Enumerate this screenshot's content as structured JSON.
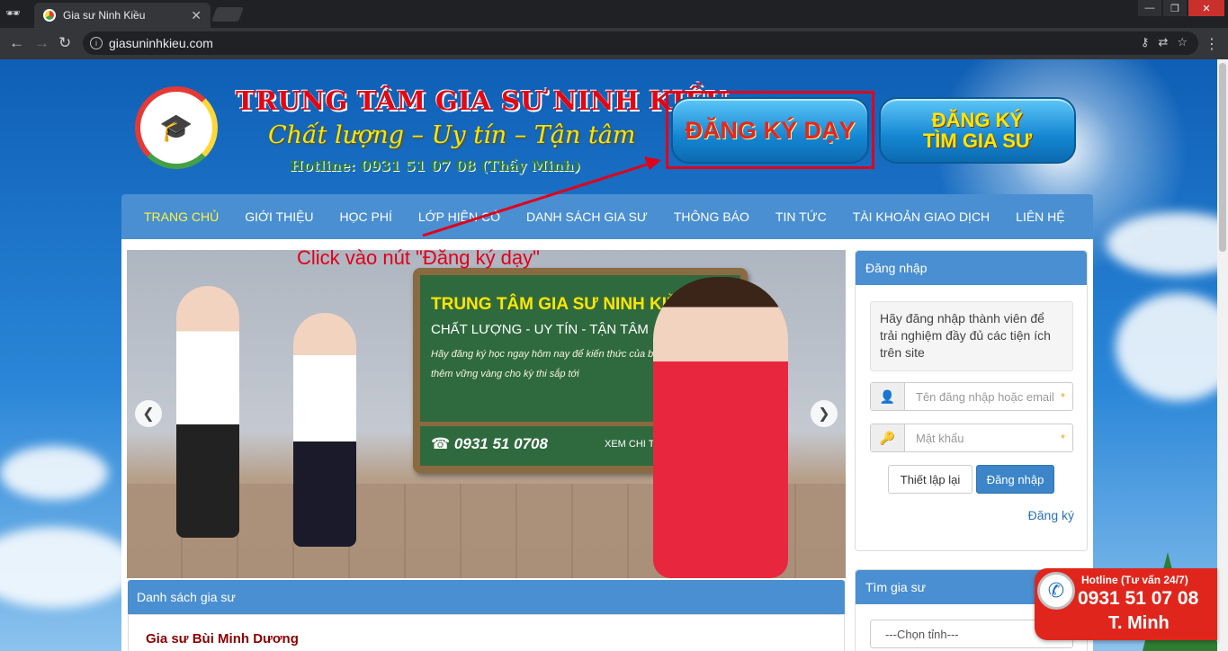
{
  "browser": {
    "tab_title": "Gia sư Ninh Kiều",
    "tab_close": "✕",
    "url": "giasuninhkieu.com",
    "window_buttons": [
      "—",
      "❐",
      "✕"
    ]
  },
  "header": {
    "title": "TRUNG TÂM GIA SƯ NINH KIỀU",
    "slogan": "Chất lượng – Uy tín – Tận tâm",
    "hotline": "Hotline: 0931 51 07 08 (Thầy Minh)",
    "register_teach": "ĐĂNG KÝ DẠY",
    "register_find_line1": "ĐĂNG KÝ",
    "register_find_line2": "TÌM GIA SƯ"
  },
  "nav": {
    "items": [
      "TRANG CHỦ",
      "GIỚI THIỆU",
      "HỌC PHÍ",
      "LỚP HIỆN CÓ",
      "DANH SÁCH GIA SƯ",
      "THÔNG BÁO",
      "TIN TỨC",
      "TÀI KHOẢN GIAO DỊCH",
      "LIÊN HỆ"
    ],
    "active": "TRANG CHỦ"
  },
  "annotation": "Click vào nút \"Đăng ký dạy\"",
  "slider": {
    "board_title": "TRUNG TÂM GIA SƯ NINH KIỀU",
    "board_subtitle": "CHẤT LƯỢNG - UY TÍN - TẬN TÂM",
    "board_line1": "Hãy đăng ký học ngay hôm nay để kiến thức của bạn",
    "board_line2": "thêm vững vàng cho kỳ thi sắp tới",
    "board_phone": "0931 51 0708",
    "board_more": "XEM CHI TIẾT >>",
    "prev": "❮",
    "next": "❯"
  },
  "login": {
    "heading": "Đăng nhập",
    "note": "Hãy đăng nhập thành viên để trải nghiệm đầy đủ các tiện ích trên site",
    "username_placeholder": "Tên đăng nhập hoặc email",
    "password_placeholder": "Mật khẩu",
    "required_mark": "*",
    "reset_label": "Thiết lập lại",
    "submit_label": "Đăng nhập",
    "register_link": "Đăng ký"
  },
  "find_tutor": {
    "heading": "Tìm gia sư",
    "province_select": "---Chọn tỉnh---"
  },
  "tutor_list": {
    "heading": "Danh sách gia sư",
    "first_tutor": "Gia sư Bùi Minh Dương"
  },
  "hotline_badge": {
    "line1": "Hotline (Tư vấn 24/7)",
    "line2": "0931 51 07 08",
    "line3": "T. Minh"
  }
}
